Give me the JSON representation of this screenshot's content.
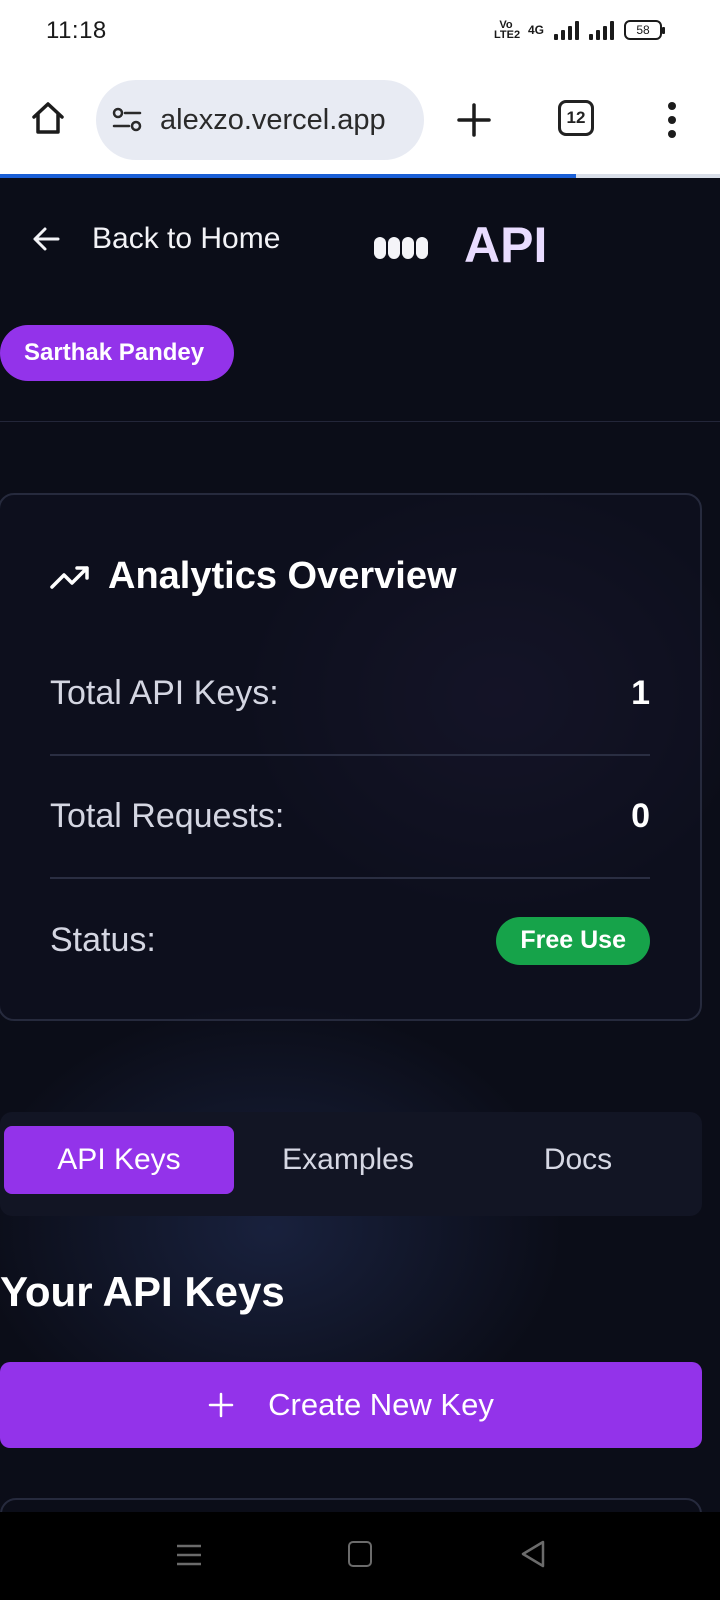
{
  "status_bar": {
    "time": "11:18",
    "volte": "Vo LTE2",
    "network": "4G",
    "battery": "58"
  },
  "browser": {
    "url": "alexzo.vercel.app",
    "tab_count": "12",
    "load_progress": 0.8
  },
  "header": {
    "back_label": "Back to Home",
    "title": "API",
    "user_name": "Sarthak Pandey"
  },
  "analytics": {
    "title": "Analytics Overview",
    "rows": [
      {
        "label": "Total API Keys:",
        "value": "1"
      },
      {
        "label": "Total Requests:",
        "value": "0"
      }
    ],
    "status_label": "Status:",
    "status_value": "Free Use"
  },
  "tabs": {
    "items": [
      "API Keys",
      "Examples",
      "Docs"
    ],
    "active": "API Keys"
  },
  "keys_section": {
    "title": "Your API Keys",
    "create_label": "Create New Key"
  },
  "colors": {
    "accent": "#9333ea",
    "success": "#16a34a",
    "background": "#0b0d18",
    "progress": "#1a5fd6"
  }
}
